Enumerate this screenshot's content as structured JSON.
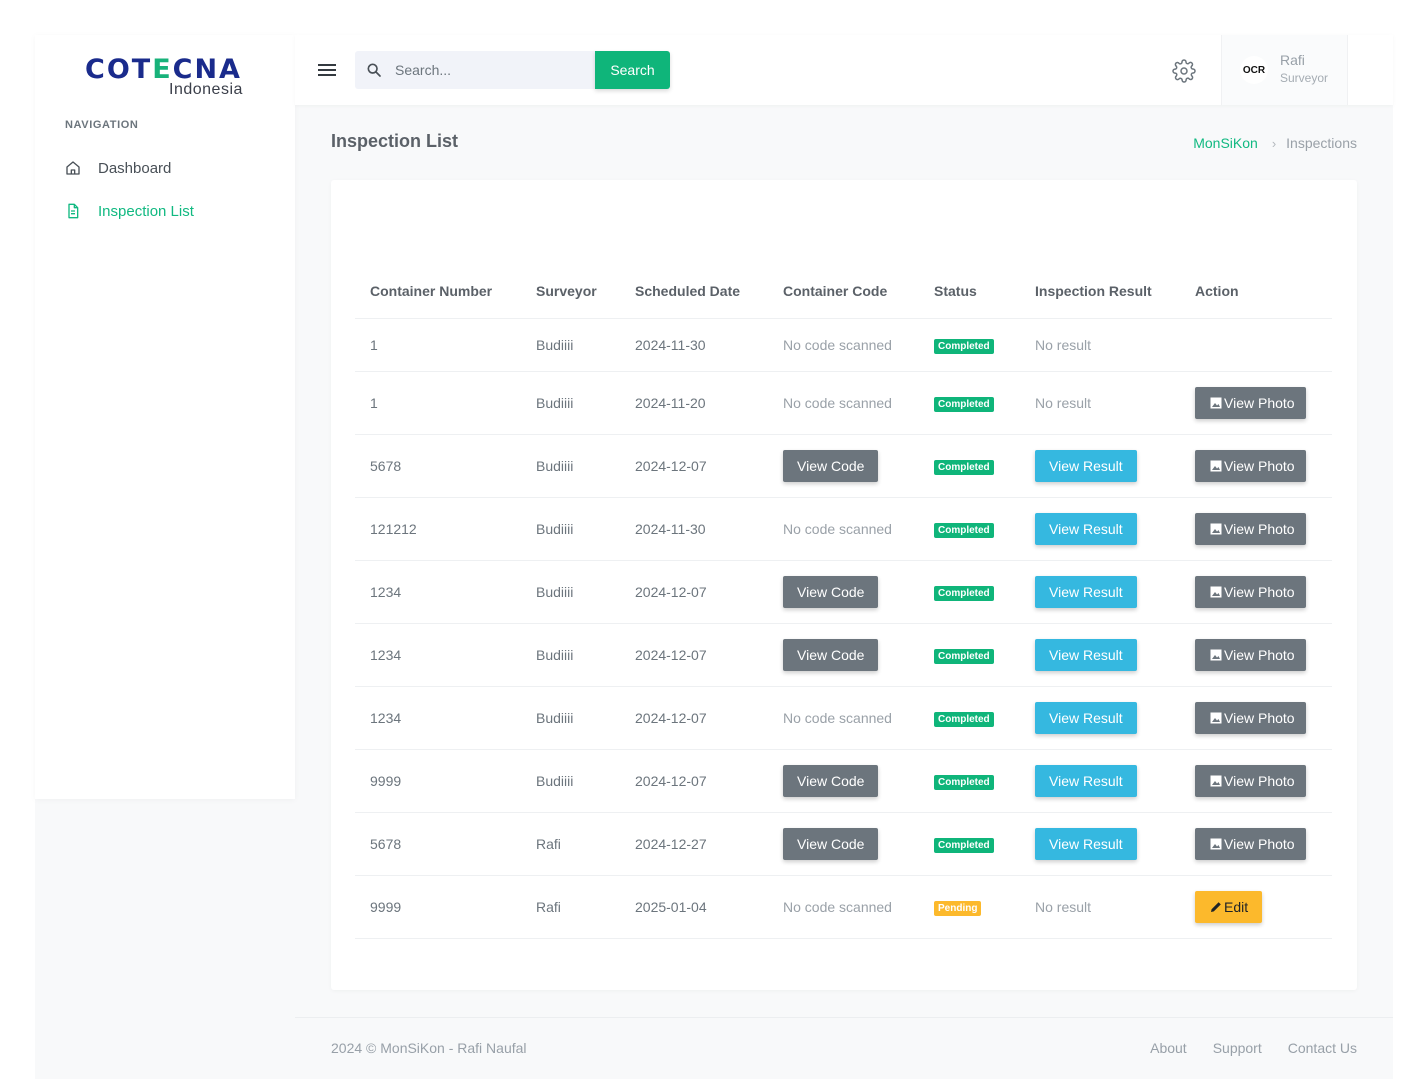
{
  "brand": {
    "logo_text": "COTECNA",
    "logo_sub": "Indonesia"
  },
  "sidebar": {
    "heading": "NAVIGATION",
    "items": [
      {
        "label": "Dashboard",
        "icon": "home-icon",
        "active": false
      },
      {
        "label": "Inspection List",
        "icon": "document-icon",
        "active": true
      }
    ]
  },
  "topbar": {
    "search_placeholder": "Search...",
    "search_button": "Search",
    "user": {
      "avatar_text": "OCR",
      "name": "Rafi",
      "role": "Surveyor"
    }
  },
  "page": {
    "title": "Inspection List",
    "breadcrumb": [
      "MonSiKon",
      "Inspections"
    ]
  },
  "table": {
    "headers": [
      "Container Number",
      "Surveyor",
      "Scheduled Date",
      "Container Code",
      "Status",
      "Inspection Result",
      "Action"
    ],
    "labels": {
      "no_code": "No code scanned",
      "view_code": "View Code",
      "no_result": "No result",
      "view_result": "View Result",
      "view_photo": "View Photo",
      "edit": "Edit"
    },
    "rows": [
      {
        "container_number": "1",
        "surveyor": "Budiiii",
        "date": "2024-11-30",
        "code": "none",
        "status": "Completed",
        "result": "none",
        "action": "none"
      },
      {
        "container_number": "1",
        "surveyor": "Budiiii",
        "date": "2024-11-20",
        "code": "none",
        "status": "Completed",
        "result": "none",
        "action": "photo"
      },
      {
        "container_number": "5678",
        "surveyor": "Budiiii",
        "date": "2024-12-07",
        "code": "button",
        "status": "Completed",
        "result": "button",
        "action": "photo"
      },
      {
        "container_number": "121212",
        "surveyor": "Budiiii",
        "date": "2024-11-30",
        "code": "none",
        "status": "Completed",
        "result": "button",
        "action": "photo"
      },
      {
        "container_number": "1234",
        "surveyor": "Budiiii",
        "date": "2024-12-07",
        "code": "button",
        "status": "Completed",
        "result": "button",
        "action": "photo"
      },
      {
        "container_number": "1234",
        "surveyor": "Budiiii",
        "date": "2024-12-07",
        "code": "button",
        "status": "Completed",
        "result": "button",
        "action": "photo"
      },
      {
        "container_number": "1234",
        "surveyor": "Budiiii",
        "date": "2024-12-07",
        "code": "none",
        "status": "Completed",
        "result": "button",
        "action": "photo"
      },
      {
        "container_number": "9999",
        "surveyor": "Budiiii",
        "date": "2024-12-07",
        "code": "button",
        "status": "Completed",
        "result": "button",
        "action": "photo"
      },
      {
        "container_number": "5678",
        "surveyor": "Rafi",
        "date": "2024-12-27",
        "code": "button",
        "status": "Completed",
        "result": "button",
        "action": "photo"
      },
      {
        "container_number": "9999",
        "surveyor": "Rafi",
        "date": "2025-01-04",
        "code": "none",
        "status": "Pending",
        "result": "none",
        "action": "edit"
      }
    ]
  },
  "footer": {
    "copyright": "2024 © MonSiKon - Rafi Naufal",
    "links": [
      "About",
      "Support",
      "Contact Us"
    ]
  },
  "colors": {
    "brand_navy": "#1a2b8c",
    "accent_green": "#0fb57a",
    "info_blue": "#35b8e0",
    "secondary_gray": "#6c757d",
    "warning_yellow": "#fcb92c"
  }
}
